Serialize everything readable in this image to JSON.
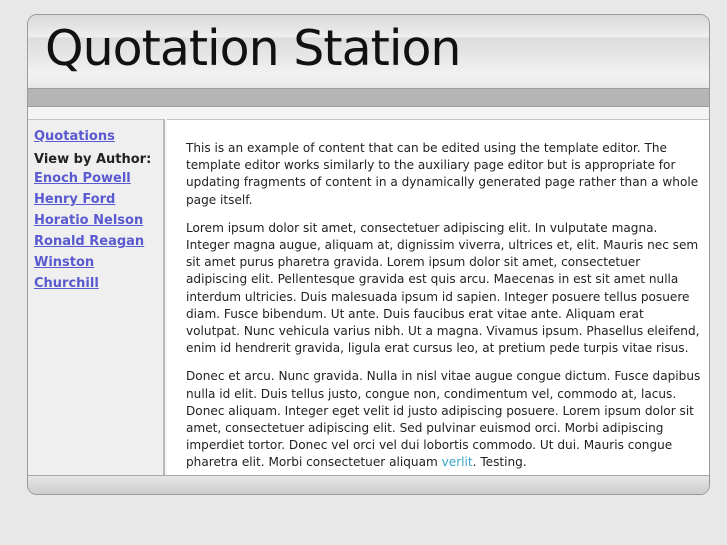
{
  "header": {
    "title": "Quotation Station"
  },
  "sidebar": {
    "quotations_link": "Quotations",
    "author_heading": "View by Author:",
    "authors": [
      "Enoch Powell",
      "Henry Ford",
      "Horatio Nelson",
      "Ronald Reagan",
      "Winston Churchill"
    ]
  },
  "content": {
    "p1": "This is an example of content that can be edited using the template editor. The template editor works similarly to the auxiliary page editor but is appropriate for updating fragments of content in a dynamically generated page rather than a whole page itself.",
    "p2": "Lorem ipsum dolor sit amet, consectetuer adipiscing elit. In vulputate magna. Integer magna augue, aliquam at, dignissim viverra, ultrices et, elit. Mauris nec sem sit amet purus pharetra gravida. Lorem ipsum dolor sit amet, consectetuer adipiscing elit. Pellentesque gravida est quis arcu. Maecenas in est sit amet nulla interdum ultricies. Duis malesuada ipsum id sapien. Integer posuere tellus posuere diam. Fusce bibendum. Ut ante. Duis faucibus erat vitae ante. Aliquam erat volutpat. Nunc vehicula varius nibh. Ut a magna. Vivamus ipsum. Phasellus eleifend, enim id hendrerit gravida, ligula erat cursus leo, at pretium pede turpis vitae risus.",
    "p3_before": "Donec et arcu. Nunc gravida. Nulla in nisl vitae augue congue dictum. Fusce dapibus nulla id elit. Duis tellus justo, congue non, condimentum vel, commodo at, lacus. Donec aliquam. Integer eget velit id justo adipiscing posuere. Lorem ipsum dolor sit amet, consectetuer adipiscing elit. Sed pulvinar euismod orci. Morbi adipiscing imperdiet tortor. Donec vel orci vel dui lobortis commodo. Ut dui. Mauris congue pharetra elit. Morbi consectetuer aliquam ",
    "p3_link": "verlit",
    "p3_after": ". Testing."
  },
  "colors": {
    "link": "#5a5ad0",
    "inline_link": "#3aa6c8",
    "header_bar": "#b5b5b5"
  }
}
